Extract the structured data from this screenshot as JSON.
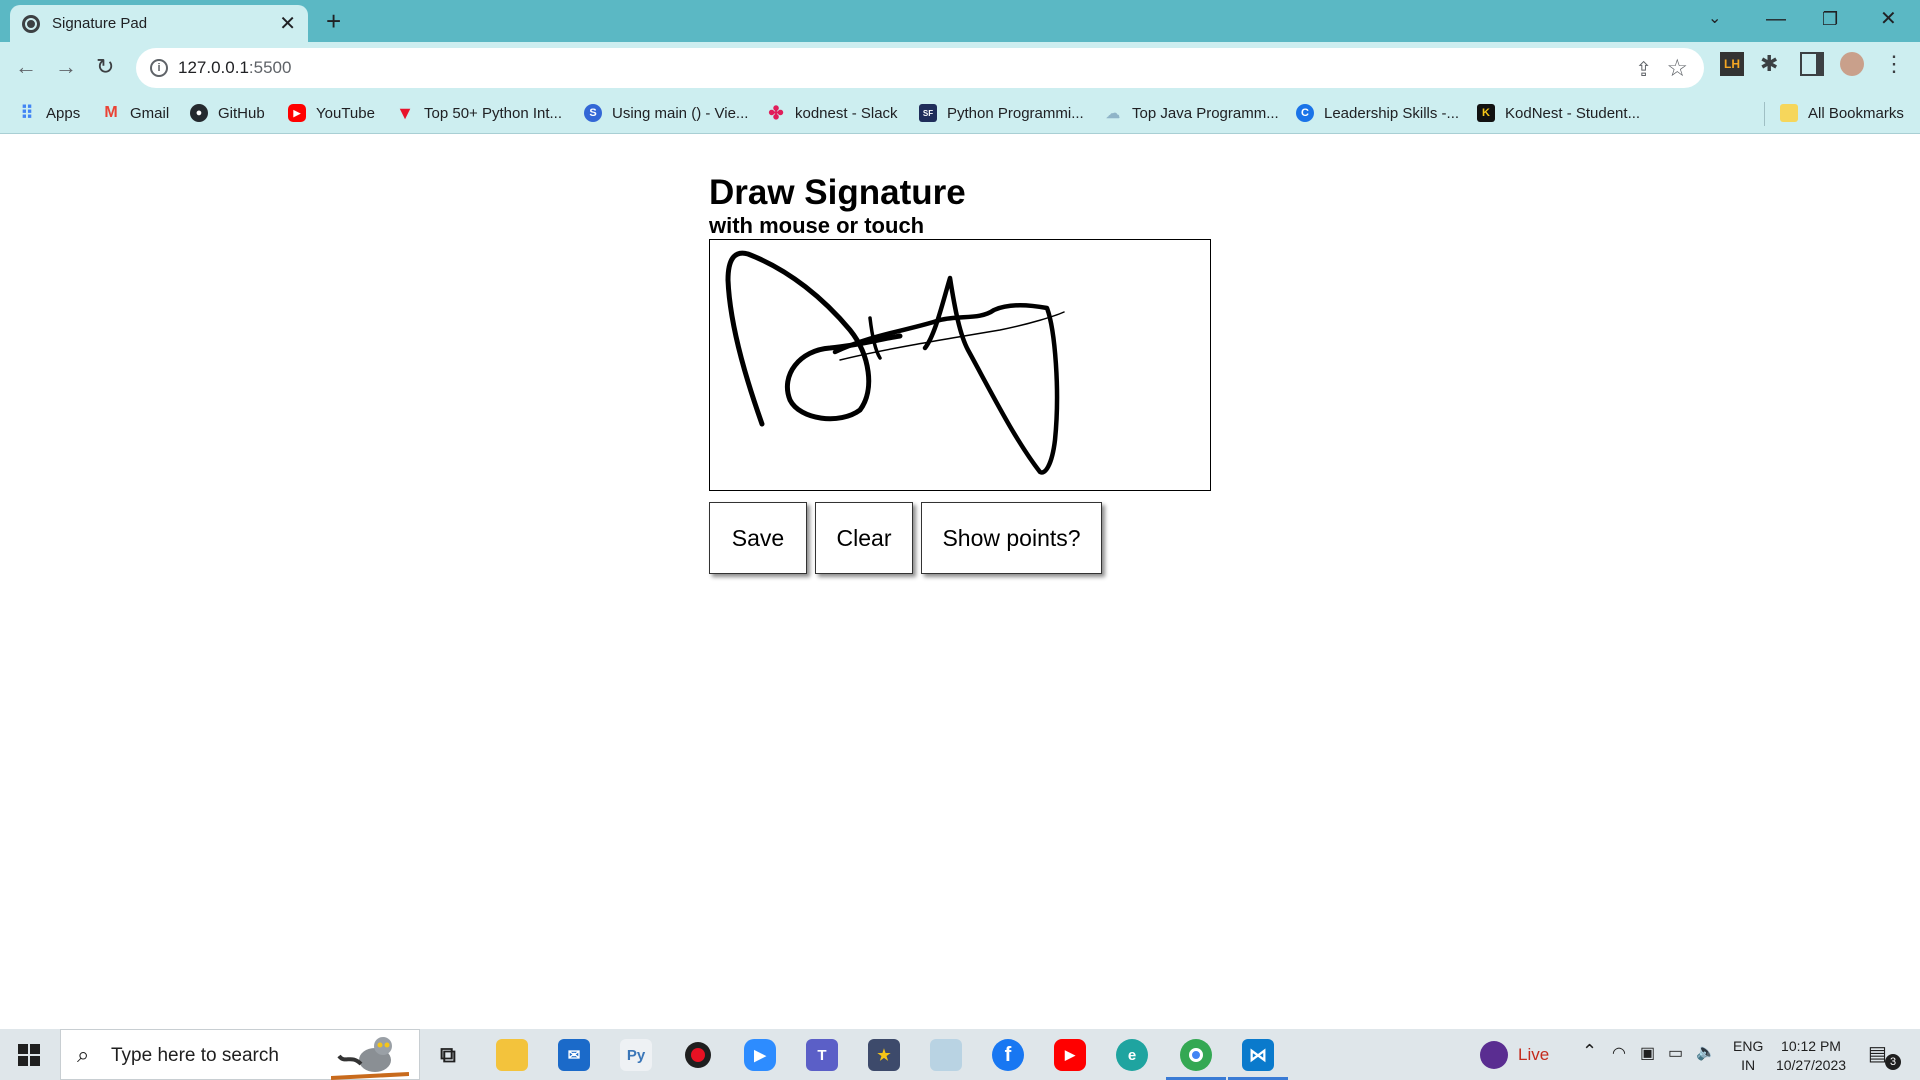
{
  "browser": {
    "tab_title": "Signature Pad",
    "url_host": "127.0.0.1",
    "url_port": ":5500",
    "bookmarks": [
      {
        "label": "Apps",
        "icon": "apps-grid-icon",
        "color": "#4285f4"
      },
      {
        "label": "Gmail",
        "icon": "gmail-icon",
        "color": "#ea4335"
      },
      {
        "label": "GitHub",
        "icon": "github-icon",
        "color": "#24292e"
      },
      {
        "label": "YouTube",
        "icon": "youtube-icon",
        "color": "#ff0000"
      },
      {
        "label": "Top 50+ Python Int...",
        "icon": "python-site-icon",
        "color": "#e8132b"
      },
      {
        "label": "Using main () - Vie...",
        "icon": "stackexchange-icon",
        "color": "#3367d6"
      },
      {
        "label": "kodnest - Slack",
        "icon": "slack-icon",
        "color": "#e01e5a"
      },
      {
        "label": "Python Programmi...",
        "icon": "sf-icon",
        "color": "#1f2d5a"
      },
      {
        "label": "Top Java Programm...",
        "icon": "java-site-icon",
        "color": "#8fb4c8"
      },
      {
        "label": "Leadership Skills -...",
        "icon": "c-site-icon",
        "color": "#1a73e8"
      },
      {
        "label": "KodNest - Student...",
        "icon": "kodnest-icon",
        "color": "#111111"
      }
    ],
    "all_bookmarks": "All Bookmarks"
  },
  "page": {
    "title": "Draw Signature",
    "subtitle": "with mouse or touch",
    "buttons": {
      "save": "Save",
      "clear": "Clear",
      "show_points": "Show points?"
    }
  },
  "taskbar": {
    "search_placeholder": "Type here to search",
    "live_label": "Live",
    "language_top": "ENG",
    "language_bottom": "IN",
    "time": "10:12 PM",
    "date": "10/27/2023",
    "notification_count": "3"
  }
}
